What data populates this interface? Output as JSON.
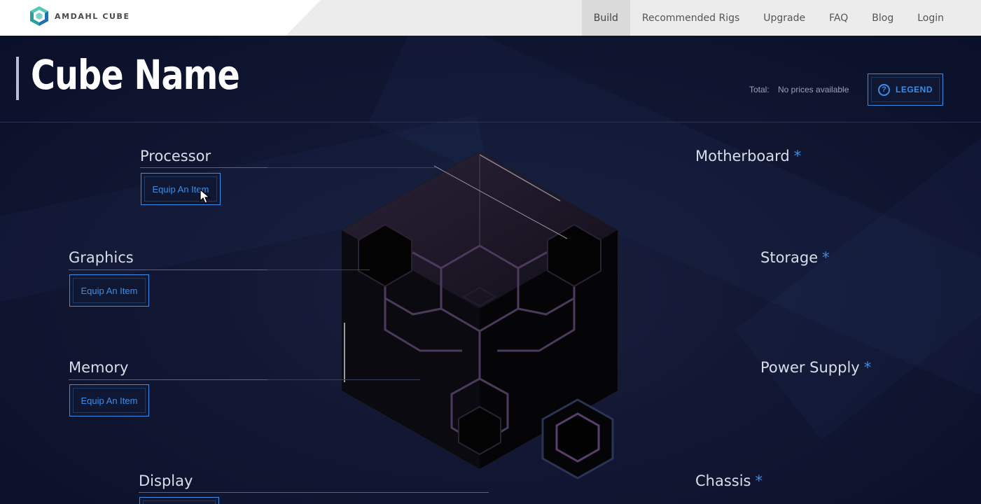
{
  "brand": {
    "name": "AMDAHL CUBE"
  },
  "nav": {
    "items": [
      {
        "label": "Build",
        "active": true
      },
      {
        "label": "Recommended Rigs"
      },
      {
        "label": "Upgrade"
      },
      {
        "label": "FAQ"
      },
      {
        "label": "Blog"
      },
      {
        "label": "Login"
      }
    ]
  },
  "header": {
    "title": "Cube Name",
    "total_label": "Total:",
    "total_value": "No prices available",
    "legend_label": "LEGEND",
    "legend_icon": "?"
  },
  "slots": {
    "left": [
      {
        "label": "Processor",
        "button": "Equip An Item"
      },
      {
        "label": "Graphics",
        "button": "Equip An Item"
      },
      {
        "label": "Memory",
        "button": "Equip An Item"
      },
      {
        "label": "Display"
      }
    ],
    "right": [
      {
        "label": "Motherboard",
        "required": "*"
      },
      {
        "label": "Storage",
        "required": "*"
      },
      {
        "label": "Power Supply",
        "required": "*"
      },
      {
        "label": "Chassis",
        "required": "*"
      }
    ]
  },
  "colors": {
    "accent": "#3a8ee8",
    "background": "#0d1229",
    "nav_background": "#ececec"
  }
}
